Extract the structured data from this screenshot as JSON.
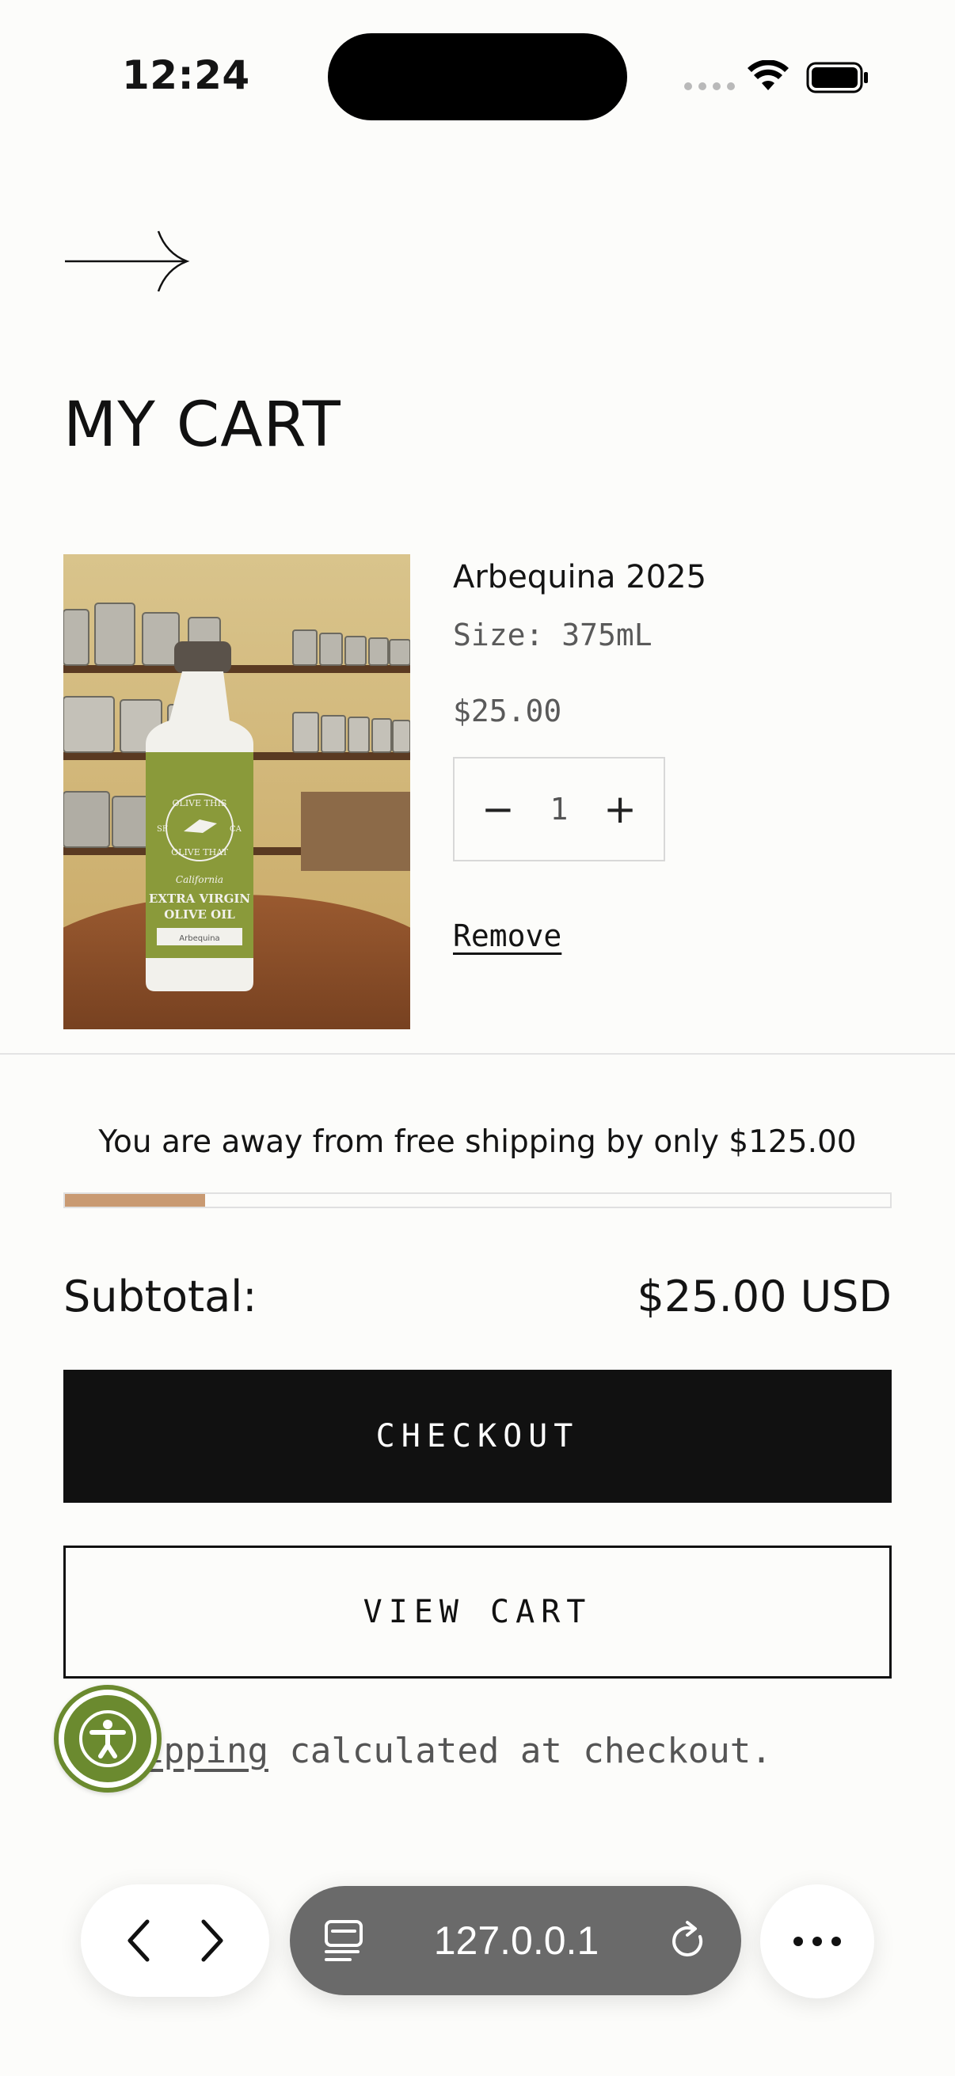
{
  "status_bar": {
    "time": "12:24"
  },
  "header": {
    "back_icon": "arrow-right-icon",
    "title": "MY CART"
  },
  "cart_item": {
    "name": "Arbequina 2025",
    "size": "Size: 375mL",
    "price": "$25.00",
    "quantity": "1",
    "decrement_label": "−",
    "increment_label": "+",
    "remove_label": "Remove",
    "image": {
      "bottle_text_top": "OLIVE THIS",
      "bottle_text_bottom": "OLIVE THAT",
      "bottle_sf": "SF",
      "bottle_ca": "CA",
      "bottle_script": "California",
      "bottle_line1": "EXTRA VIRGIN",
      "bottle_line2": "OLIVE OIL",
      "bottle_variety": "Arbequina"
    }
  },
  "shipping": {
    "message": "You are away from free shipping by only $125.00",
    "progress": 0.17
  },
  "summary": {
    "subtotal_label": "Subtotal:",
    "subtotal_value": "$25.00 USD"
  },
  "actions": {
    "checkout_label": "CHECKOUT",
    "view_cart_label": "VIEW CART"
  },
  "note": {
    "link_text": "ipping",
    "rest_text": " calculated at checkout."
  },
  "browser": {
    "url": "127.0.0.1",
    "back_icon": "chevron-left-icon",
    "forward_icon": "chevron-right-icon",
    "tabs_icon": "reader-icon",
    "reload_icon": "reload-icon",
    "more_icon": "more-icon"
  },
  "colors": {
    "progress_fill": "#c99a72",
    "accessibility_green": "#6b8a2f",
    "bottle_green": "#8a9a3a"
  }
}
